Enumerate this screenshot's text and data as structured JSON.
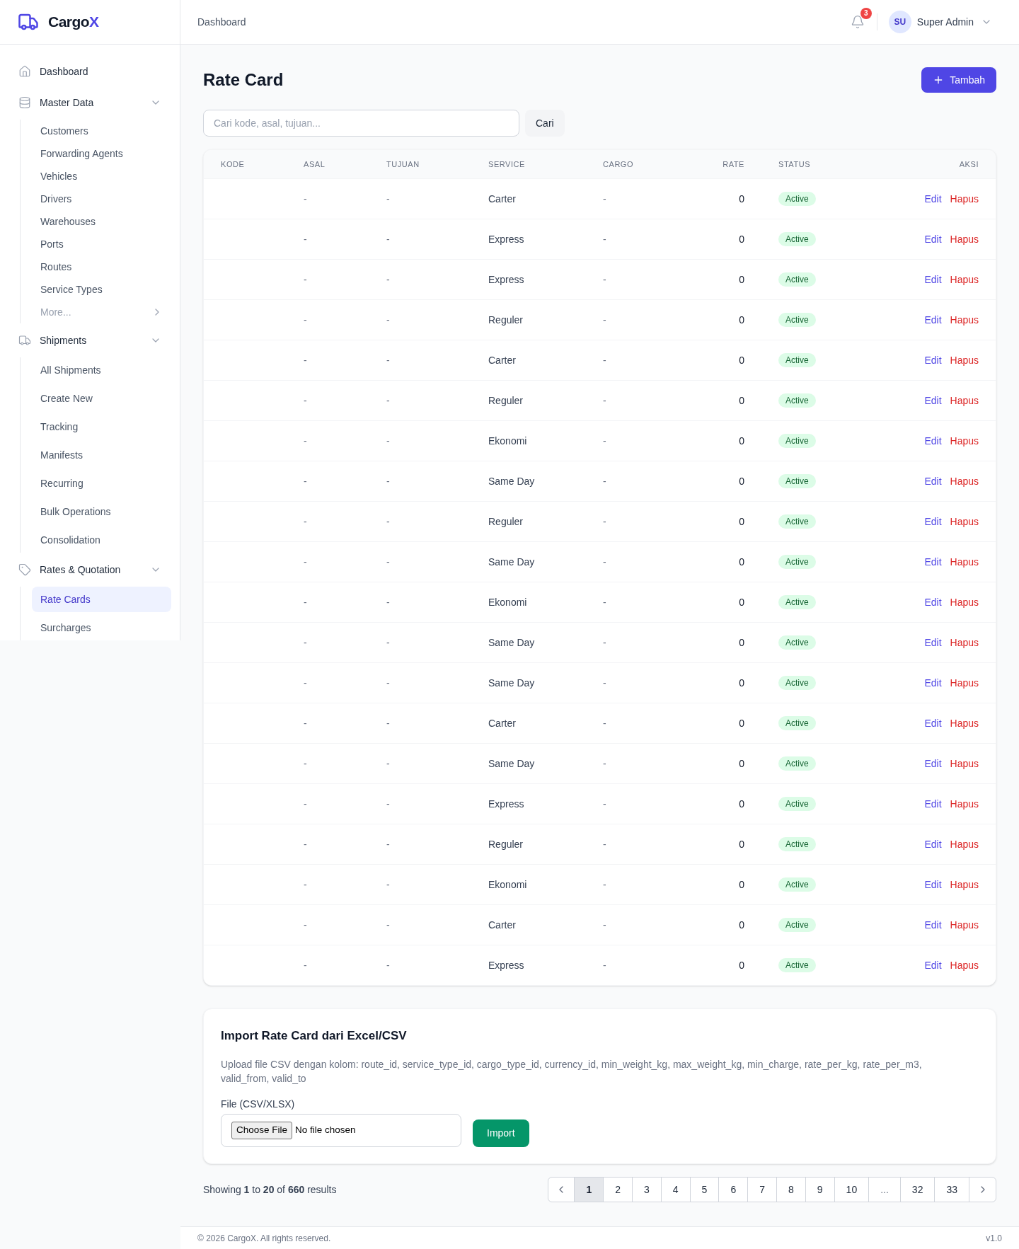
{
  "sidebar": {
    "brand": {
      "name": "Cargo",
      "accent": "X"
    },
    "items": [
      {
        "kind": "link",
        "label": "Dashboard",
        "selected": false
      },
      {
        "kind": "group",
        "label": "Master Data",
        "expanded": true,
        "children": [
          {
            "label": "Customers",
            "selected": false
          },
          {
            "label": "Forwarding Agents",
            "selected": false
          },
          {
            "label": "Vehicles",
            "selected": false
          },
          {
            "label": "Drivers",
            "selected": false
          },
          {
            "label": "Warehouses",
            "selected": false
          },
          {
            "label": "Ports",
            "selected": false
          },
          {
            "label": "Routes",
            "selected": false
          },
          {
            "label": "Service Types",
            "selected": false
          }
        ],
        "more": "More..."
      },
      {
        "kind": "group",
        "label": "Shipments",
        "expanded": true,
        "children": [
          {
            "label": "All Shipments",
            "selected": false
          },
          {
            "label": "Create New",
            "selected": false
          },
          {
            "label": "Tracking",
            "selected": false
          },
          {
            "label": "Manifests",
            "selected": false
          },
          {
            "label": "Recurring",
            "selected": false
          },
          {
            "label": "Bulk Operations",
            "selected": false
          },
          {
            "label": "Consolidation",
            "selected": false
          }
        ]
      },
      {
        "kind": "group",
        "label": "Rates & Quotation",
        "expanded": true,
        "children": [
          {
            "label": "Rate Cards",
            "selected": true
          },
          {
            "label": "Surcharges",
            "selected": false
          }
        ]
      }
    ]
  },
  "header": {
    "breadcrumb": "Dashboard",
    "notification_count": "3",
    "user": {
      "initials": "SU",
      "name": "Super Admin"
    }
  },
  "page": {
    "title": "Rate Card",
    "add_button": "Tambah",
    "search": {
      "placeholder": "Cari kode, asal, tujuan...",
      "button": "Cari"
    }
  },
  "table": {
    "columns": [
      "KODE",
      "ASAL",
      "TUJUAN",
      "SERVICE",
      "CARGO",
      "RATE",
      "STATUS",
      "AKSI"
    ],
    "rows": [
      {
        "asal": "-",
        "tujuan": "-",
        "service": "Carter",
        "cargo": "-",
        "rate": "0",
        "status": "Active",
        "active": true,
        "actions": [
          {
            "kind": "edit",
            "label": "Edit"
          },
          {
            "kind": "delete",
            "label": "Hapus"
          }
        ]
      },
      {
        "asal": "-",
        "tujuan": "-",
        "service": "Express",
        "cargo": "-",
        "rate": "0",
        "status": "Active",
        "active": true,
        "actions": [
          {
            "kind": "edit",
            "label": "Edit"
          },
          {
            "kind": "delete",
            "label": "Hapus"
          }
        ]
      },
      {
        "asal": "-",
        "tujuan": "-",
        "service": "Express",
        "cargo": "-",
        "rate": "0",
        "status": "Active",
        "active": true,
        "actions": [
          {
            "kind": "edit",
            "label": "Edit"
          },
          {
            "kind": "delete",
            "label": "Hapus"
          }
        ]
      },
      {
        "asal": "-",
        "tujuan": "-",
        "service": "Reguler",
        "cargo": "-",
        "rate": "0",
        "status": "Active",
        "active": true,
        "actions": [
          {
            "kind": "edit",
            "label": "Edit"
          },
          {
            "kind": "delete",
            "label": "Hapus"
          }
        ]
      },
      {
        "asal": "-",
        "tujuan": "-",
        "service": "Carter",
        "cargo": "-",
        "rate": "0",
        "status": "Active",
        "active": true,
        "actions": [
          {
            "kind": "edit",
            "label": "Edit"
          },
          {
            "kind": "delete",
            "label": "Hapus"
          }
        ]
      },
      {
        "asal": "-",
        "tujuan": "-",
        "service": "Reguler",
        "cargo": "-",
        "rate": "0",
        "status": "Active",
        "active": true,
        "actions": [
          {
            "kind": "edit",
            "label": "Edit"
          },
          {
            "kind": "delete",
            "label": "Hapus"
          }
        ]
      },
      {
        "asal": "-",
        "tujuan": "-",
        "service": "Ekonomi",
        "cargo": "-",
        "rate": "0",
        "status": "Active",
        "active": true,
        "actions": [
          {
            "kind": "edit",
            "label": "Edit"
          },
          {
            "kind": "delete",
            "label": "Hapus"
          }
        ]
      },
      {
        "asal": "-",
        "tujuan": "-",
        "service": "Same Day",
        "cargo": "-",
        "rate": "0",
        "status": "Active",
        "active": true,
        "actions": [
          {
            "kind": "edit",
            "label": "Edit"
          },
          {
            "kind": "delete",
            "label": "Hapus"
          }
        ]
      },
      {
        "asal": "-",
        "tujuan": "-",
        "service": "Reguler",
        "cargo": "-",
        "rate": "0",
        "status": "Active",
        "active": true,
        "actions": [
          {
            "kind": "edit",
            "label": "Edit"
          },
          {
            "kind": "delete",
            "label": "Hapus"
          }
        ]
      },
      {
        "asal": "-",
        "tujuan": "-",
        "service": "Same Day",
        "cargo": "-",
        "rate": "0",
        "status": "Active",
        "active": true,
        "actions": [
          {
            "kind": "edit",
            "label": "Edit"
          },
          {
            "kind": "delete",
            "label": "Hapus"
          }
        ]
      },
      {
        "asal": "-",
        "tujuan": "-",
        "service": "Ekonomi",
        "cargo": "-",
        "rate": "0",
        "status": "Active",
        "active": true,
        "actions": [
          {
            "kind": "edit",
            "label": "Edit"
          },
          {
            "kind": "delete",
            "label": "Hapus"
          }
        ]
      },
      {
        "asal": "-",
        "tujuan": "-",
        "service": "Same Day",
        "cargo": "-",
        "rate": "0",
        "status": "Active",
        "active": true,
        "actions": [
          {
            "kind": "edit",
            "label": "Edit"
          },
          {
            "kind": "delete",
            "label": "Hapus"
          }
        ]
      },
      {
        "asal": "-",
        "tujuan": "-",
        "service": "Same Day",
        "cargo": "-",
        "rate": "0",
        "status": "Active",
        "active": true,
        "actions": [
          {
            "kind": "edit",
            "label": "Edit"
          },
          {
            "kind": "delete",
            "label": "Hapus"
          }
        ]
      },
      {
        "asal": "-",
        "tujuan": "-",
        "service": "Carter",
        "cargo": "-",
        "rate": "0",
        "status": "Active",
        "active": true,
        "actions": [
          {
            "kind": "edit",
            "label": "Edit"
          },
          {
            "kind": "delete",
            "label": "Hapus"
          }
        ]
      },
      {
        "asal": "-",
        "tujuan": "-",
        "service": "Same Day",
        "cargo": "-",
        "rate": "0",
        "status": "Active",
        "active": true,
        "actions": [
          {
            "kind": "edit",
            "label": "Edit"
          },
          {
            "kind": "delete",
            "label": "Hapus"
          }
        ]
      },
      {
        "asal": "-",
        "tujuan": "-",
        "service": "Express",
        "cargo": "-",
        "rate": "0",
        "status": "Active",
        "active": true,
        "actions": [
          {
            "kind": "edit",
            "label": "Edit"
          },
          {
            "kind": "delete",
            "label": "Hapus"
          }
        ]
      },
      {
        "asal": "-",
        "tujuan": "-",
        "service": "Reguler",
        "cargo": "-",
        "rate": "0",
        "status": "Active",
        "active": true,
        "actions": [
          {
            "kind": "edit",
            "label": "Edit"
          },
          {
            "kind": "delete",
            "label": "Hapus"
          }
        ]
      },
      {
        "asal": "-",
        "tujuan": "-",
        "service": "Ekonomi",
        "cargo": "-",
        "rate": "0",
        "status": "Active",
        "active": true,
        "actions": [
          {
            "kind": "edit",
            "label": "Edit"
          },
          {
            "kind": "delete",
            "label": "Hapus"
          }
        ]
      },
      {
        "asal": "-",
        "tujuan": "-",
        "service": "Carter",
        "cargo": "-",
        "rate": "0",
        "status": "Active",
        "active": true,
        "actions": [
          {
            "kind": "edit",
            "label": "Edit"
          },
          {
            "kind": "delete",
            "label": "Hapus"
          }
        ]
      },
      {
        "asal": "-",
        "tujuan": "-",
        "service": "Express",
        "cargo": "-",
        "rate": "0",
        "status": "Active",
        "active": true,
        "actions": [
          {
            "kind": "edit",
            "label": "Edit"
          },
          {
            "kind": "delete",
            "label": "Hapus"
          }
        ]
      }
    ]
  },
  "import": {
    "title": "Import Rate Card dari Excel/CSV",
    "description": "Upload file CSV dengan kolom: route_id, service_type_id, cargo_type_id, currency_id, min_weight_kg, max_weight_kg, min_charge, rate_per_kg, rate_per_m3, valid_from, valid_to",
    "file_label": "File (CSV/XLSX)",
    "file_button": "Choose File",
    "file_status": "No file chosen",
    "submit": "Import"
  },
  "pagination": {
    "summary": "Showing **1** to **20** of **660** results",
    "pages": [
      {
        "kind": "page",
        "label": "1",
        "selected": true
      },
      {
        "kind": "page",
        "label": "2",
        "selected": false
      },
      {
        "kind": "page",
        "label": "3",
        "selected": false
      },
      {
        "kind": "page",
        "label": "4",
        "selected": false
      },
      {
        "kind": "page",
        "label": "5",
        "selected": false
      },
      {
        "kind": "page",
        "label": "6",
        "selected": false
      },
      {
        "kind": "page",
        "label": "7",
        "selected": false
      },
      {
        "kind": "page",
        "label": "8",
        "selected": false
      },
      {
        "kind": "page",
        "label": "9",
        "selected": false
      },
      {
        "kind": "page",
        "label": "10",
        "selected": false
      },
      {
        "kind": "ellipsis",
        "label": "...",
        "selected": false
      },
      {
        "kind": "page",
        "label": "32",
        "selected": false
      },
      {
        "kind": "page",
        "label": "33",
        "selected": false
      }
    ]
  },
  "footer": {
    "copyright": "© 2026 CargoX. All rights reserved.",
    "version": "v1.0"
  }
}
